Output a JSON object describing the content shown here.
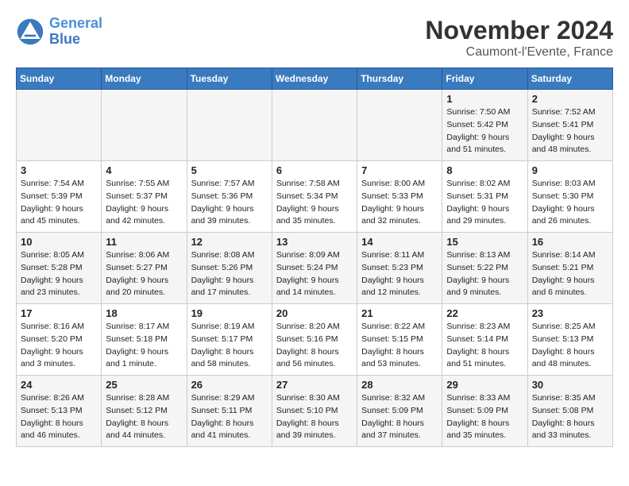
{
  "logo": {
    "line1": "General",
    "line2": "Blue"
  },
  "title": "November 2024",
  "location": "Caumont-l'Evente, France",
  "headers": [
    "Sunday",
    "Monday",
    "Tuesday",
    "Wednesday",
    "Thursday",
    "Friday",
    "Saturday"
  ],
  "weeks": [
    [
      {
        "day": "",
        "info": ""
      },
      {
        "day": "",
        "info": ""
      },
      {
        "day": "",
        "info": ""
      },
      {
        "day": "",
        "info": ""
      },
      {
        "day": "",
        "info": ""
      },
      {
        "day": "1",
        "info": "Sunrise: 7:50 AM\nSunset: 5:42 PM\nDaylight: 9 hours\nand 51 minutes."
      },
      {
        "day": "2",
        "info": "Sunrise: 7:52 AM\nSunset: 5:41 PM\nDaylight: 9 hours\nand 48 minutes."
      }
    ],
    [
      {
        "day": "3",
        "info": "Sunrise: 7:54 AM\nSunset: 5:39 PM\nDaylight: 9 hours\nand 45 minutes."
      },
      {
        "day": "4",
        "info": "Sunrise: 7:55 AM\nSunset: 5:37 PM\nDaylight: 9 hours\nand 42 minutes."
      },
      {
        "day": "5",
        "info": "Sunrise: 7:57 AM\nSunset: 5:36 PM\nDaylight: 9 hours\nand 39 minutes."
      },
      {
        "day": "6",
        "info": "Sunrise: 7:58 AM\nSunset: 5:34 PM\nDaylight: 9 hours\nand 35 minutes."
      },
      {
        "day": "7",
        "info": "Sunrise: 8:00 AM\nSunset: 5:33 PM\nDaylight: 9 hours\nand 32 minutes."
      },
      {
        "day": "8",
        "info": "Sunrise: 8:02 AM\nSunset: 5:31 PM\nDaylight: 9 hours\nand 29 minutes."
      },
      {
        "day": "9",
        "info": "Sunrise: 8:03 AM\nSunset: 5:30 PM\nDaylight: 9 hours\nand 26 minutes."
      }
    ],
    [
      {
        "day": "10",
        "info": "Sunrise: 8:05 AM\nSunset: 5:28 PM\nDaylight: 9 hours\nand 23 minutes."
      },
      {
        "day": "11",
        "info": "Sunrise: 8:06 AM\nSunset: 5:27 PM\nDaylight: 9 hours\nand 20 minutes."
      },
      {
        "day": "12",
        "info": "Sunrise: 8:08 AM\nSunset: 5:26 PM\nDaylight: 9 hours\nand 17 minutes."
      },
      {
        "day": "13",
        "info": "Sunrise: 8:09 AM\nSunset: 5:24 PM\nDaylight: 9 hours\nand 14 minutes."
      },
      {
        "day": "14",
        "info": "Sunrise: 8:11 AM\nSunset: 5:23 PM\nDaylight: 9 hours\nand 12 minutes."
      },
      {
        "day": "15",
        "info": "Sunrise: 8:13 AM\nSunset: 5:22 PM\nDaylight: 9 hours\nand 9 minutes."
      },
      {
        "day": "16",
        "info": "Sunrise: 8:14 AM\nSunset: 5:21 PM\nDaylight: 9 hours\nand 6 minutes."
      }
    ],
    [
      {
        "day": "17",
        "info": "Sunrise: 8:16 AM\nSunset: 5:20 PM\nDaylight: 9 hours\nand 3 minutes."
      },
      {
        "day": "18",
        "info": "Sunrise: 8:17 AM\nSunset: 5:18 PM\nDaylight: 9 hours\nand 1 minute."
      },
      {
        "day": "19",
        "info": "Sunrise: 8:19 AM\nSunset: 5:17 PM\nDaylight: 8 hours\nand 58 minutes."
      },
      {
        "day": "20",
        "info": "Sunrise: 8:20 AM\nSunset: 5:16 PM\nDaylight: 8 hours\nand 56 minutes."
      },
      {
        "day": "21",
        "info": "Sunrise: 8:22 AM\nSunset: 5:15 PM\nDaylight: 8 hours\nand 53 minutes."
      },
      {
        "day": "22",
        "info": "Sunrise: 8:23 AM\nSunset: 5:14 PM\nDaylight: 8 hours\nand 51 minutes."
      },
      {
        "day": "23",
        "info": "Sunrise: 8:25 AM\nSunset: 5:13 PM\nDaylight: 8 hours\nand 48 minutes."
      }
    ],
    [
      {
        "day": "24",
        "info": "Sunrise: 8:26 AM\nSunset: 5:13 PM\nDaylight: 8 hours\nand 46 minutes."
      },
      {
        "day": "25",
        "info": "Sunrise: 8:28 AM\nSunset: 5:12 PM\nDaylight: 8 hours\nand 44 minutes."
      },
      {
        "day": "26",
        "info": "Sunrise: 8:29 AM\nSunset: 5:11 PM\nDaylight: 8 hours\nand 41 minutes."
      },
      {
        "day": "27",
        "info": "Sunrise: 8:30 AM\nSunset: 5:10 PM\nDaylight: 8 hours\nand 39 minutes."
      },
      {
        "day": "28",
        "info": "Sunrise: 8:32 AM\nSunset: 5:09 PM\nDaylight: 8 hours\nand 37 minutes."
      },
      {
        "day": "29",
        "info": "Sunrise: 8:33 AM\nSunset: 5:09 PM\nDaylight: 8 hours\nand 35 minutes."
      },
      {
        "day": "30",
        "info": "Sunrise: 8:35 AM\nSunset: 5:08 PM\nDaylight: 8 hours\nand 33 minutes."
      }
    ]
  ]
}
